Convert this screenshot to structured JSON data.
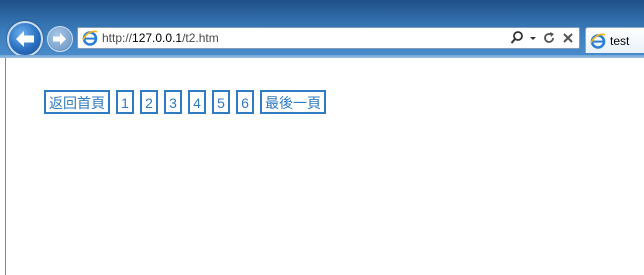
{
  "browser": {
    "url_prefix": "http://",
    "url_host": "127.0.0.1",
    "url_path": "/t2.htm",
    "tab_title": "test",
    "icons": {
      "back": "back-arrow-icon",
      "forward": "forward-arrow-icon",
      "page": "ie-page-icon",
      "search": "search-icon",
      "dropdown": "chevron-down-icon",
      "refresh": "refresh-icon",
      "stop": "close-icon"
    }
  },
  "pager": {
    "first_label": "返回首頁",
    "pages": [
      "1",
      "2",
      "3",
      "4",
      "5",
      "6"
    ],
    "last_label": "最後一頁"
  },
  "colors": {
    "link": "#2f7bc4",
    "chrome": "#3f80bf"
  }
}
